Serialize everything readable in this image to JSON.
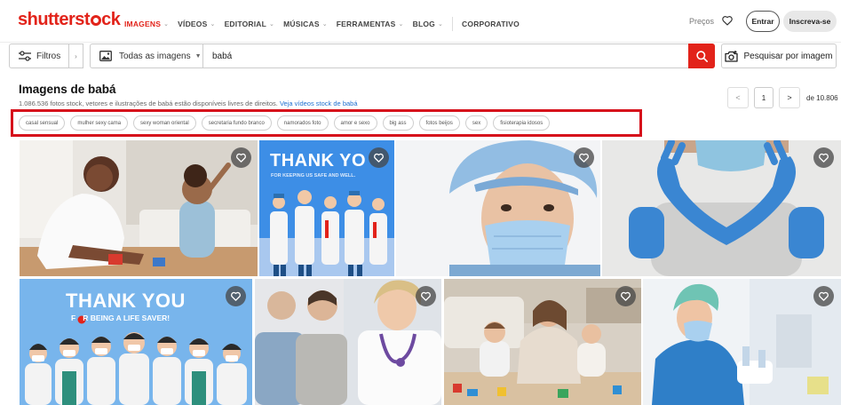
{
  "brand": {
    "logo_pre": "shutterst",
    "logo_post": "ck"
  },
  "nav": {
    "items": [
      {
        "label": "IMAGENS",
        "active": true,
        "caret": true
      },
      {
        "label": "VÍDEOS",
        "active": false,
        "caret": true
      },
      {
        "label": "EDITORIAL",
        "active": false,
        "caret": true
      },
      {
        "label": "MÚSICAS",
        "active": false,
        "caret": true
      },
      {
        "label": "FERRAMENTAS",
        "active": false,
        "caret": true
      },
      {
        "label": "BLOG",
        "active": false,
        "caret": true
      }
    ],
    "corporate_label": "CORPORATIVO",
    "pricing_label": "Preços",
    "login_label": "Entrar",
    "signup_label": "Inscreva-se"
  },
  "search": {
    "filters_label": "Filtros",
    "type_label": "Todas as imagens",
    "query": "babá",
    "image_search_label": "Pesquisar por imagem"
  },
  "results": {
    "title": "Imagens de babá",
    "summary": "1.086.536 fotos stock, vetores e ilustrações de babá estão disponíveis livres de direitos.",
    "video_link": "Veja vídeos stock de babá",
    "page_current": "1",
    "page_total": "de 10.806"
  },
  "related_tags": [
    "casal sensual",
    "mulher sexy cama",
    "sexy woman oriental",
    "secretaria fundo branco",
    "namorados foto",
    "amor e sexo",
    "big ass",
    "fotos beijos",
    "sex",
    "fisioterapia idosos"
  ],
  "tile_texts": {
    "thank_you_1_title": "THANK YO",
    "thank_you_1_sub": "FOR KEEPING US SAFE AND WELL.",
    "thank_you_2_title": "THANK YOU",
    "thank_you_2_sub_a": "F",
    "thank_you_2_sub_b": "R BEING A LIFE SAVER!"
  },
  "colors": {
    "accent": "#e2231a",
    "tag_highlight": "#d6101b",
    "link": "#1d6fd0"
  },
  "icons": [
    "sliders-icon",
    "image-icon",
    "search-icon",
    "camera-icon",
    "heart-icon"
  ]
}
